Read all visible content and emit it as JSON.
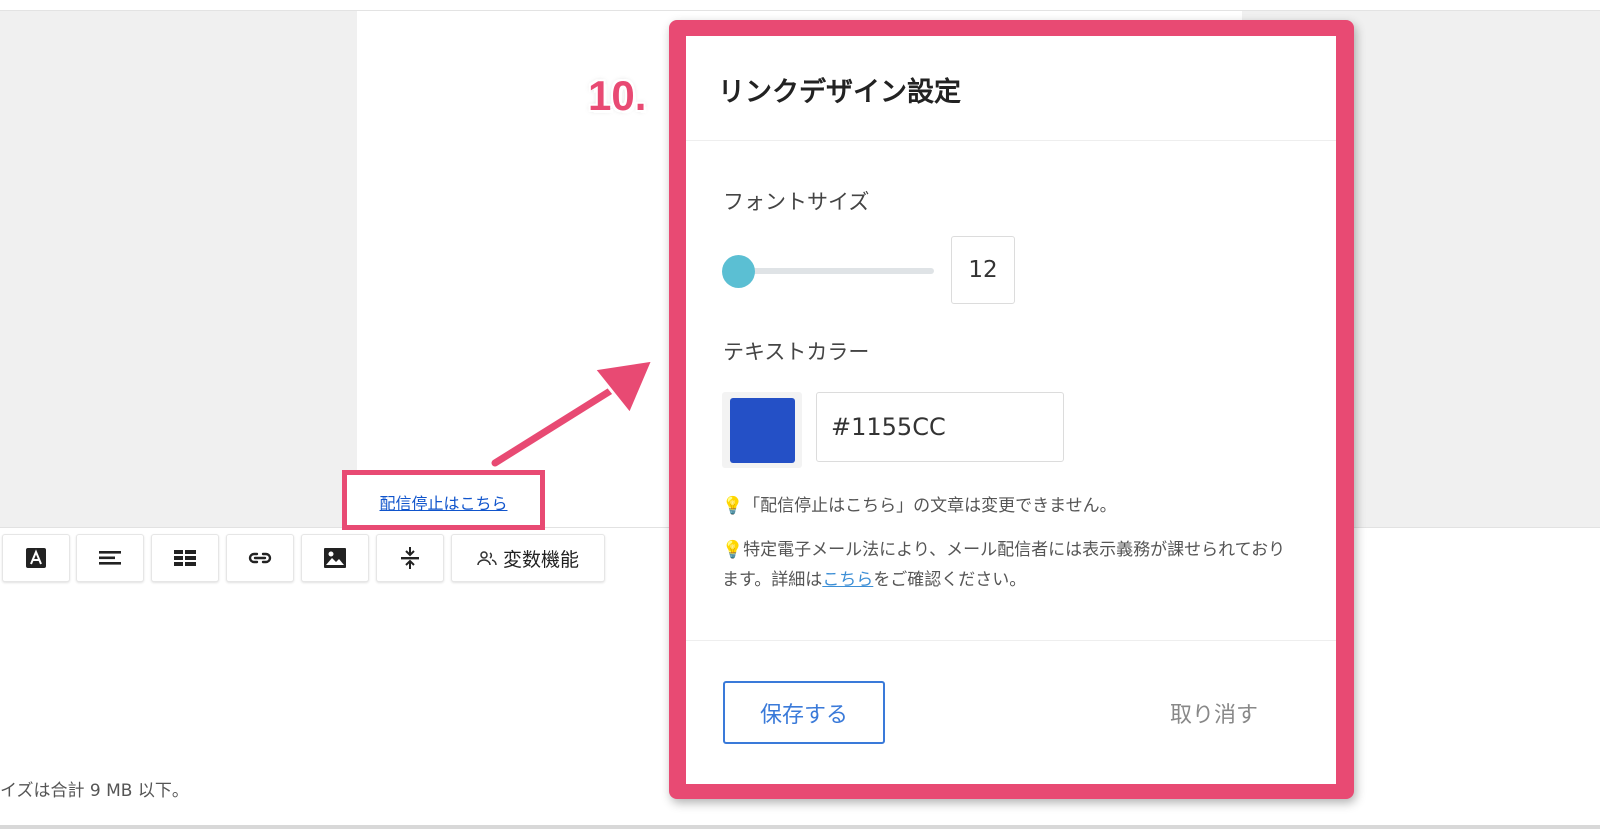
{
  "annotation": {
    "step": "10."
  },
  "canvas": {
    "unsubscribe_link": "配信停止はこちら",
    "footer_note": "イズは合計 9 MB 以下。"
  },
  "toolbar": {
    "buttons": [
      {
        "icon": "text-color-icon"
      },
      {
        "icon": "align-left-icon"
      },
      {
        "icon": "table-icon"
      },
      {
        "icon": "link-icon"
      },
      {
        "icon": "image-icon"
      },
      {
        "icon": "divider-icon"
      }
    ],
    "variables_label": "変数機能"
  },
  "modal": {
    "title": "リンクデザイン設定",
    "font_size_label": "フォントサイズ",
    "font_size_value": "12",
    "font_size_slider_fraction": 0.0,
    "text_color_label": "テキストカラー",
    "text_color_value": "#1155CC",
    "swatch_color": "#2450c6",
    "note1": "「配信停止はこちら」の文章は変更できません。",
    "note2_prefix": "特定電子メール法により、メール配信者には表示義務が課せられております。詳細は",
    "note2_link": "こちら",
    "note2_suffix": "をご確認ください。",
    "save_label": "保存する",
    "cancel_label": "取り消す"
  },
  "colors": {
    "highlight": "#e84a73",
    "link": "#1155cc",
    "accent": "#3a7ad9",
    "slider_thumb": "#5bbfd3"
  }
}
